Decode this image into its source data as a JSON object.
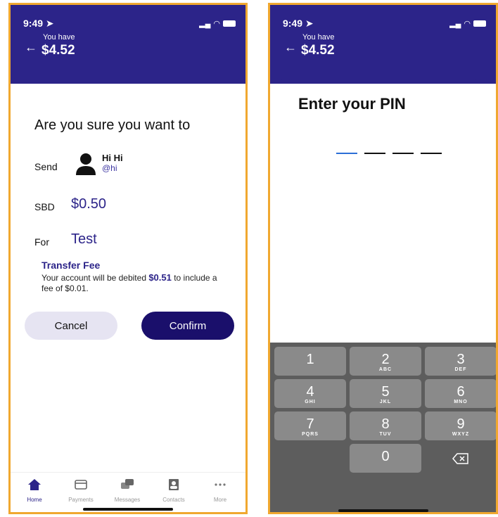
{
  "status": {
    "time": "9:49",
    "location_icon": "location-arrow-icon"
  },
  "left": {
    "header": {
      "you_have": "You have",
      "balance": "$4.52"
    },
    "title": "Are you sure you want to",
    "send_label": "Send",
    "recipient": {
      "name": "Hi Hi",
      "handle": "@hi"
    },
    "currency_label": "SBD",
    "amount": "$0.50",
    "for_label": "For",
    "memo": "Test",
    "fee": {
      "title": "Transfer Fee",
      "text_before": "Your account will be debited ",
      "debit_amount": "$0.51",
      "text_after": " to include a fee of $0.01."
    },
    "buttons": {
      "cancel": "Cancel",
      "confirm": "Confirm"
    },
    "tabs": [
      {
        "label": "Home",
        "icon": "home-icon"
      },
      {
        "label": "Payments",
        "icon": "card-icon"
      },
      {
        "label": "Messages",
        "icon": "messages-icon"
      },
      {
        "label": "Contacts",
        "icon": "contacts-icon"
      },
      {
        "label": "More",
        "icon": "more-icon"
      }
    ]
  },
  "right": {
    "header": {
      "you_have": "You have",
      "balance": "$4.52"
    },
    "title": "Enter your PIN",
    "keys": [
      {
        "num": "1",
        "letters": ""
      },
      {
        "num": "2",
        "letters": "ABC"
      },
      {
        "num": "3",
        "letters": "DEF"
      },
      {
        "num": "4",
        "letters": "GHI"
      },
      {
        "num": "5",
        "letters": "JKL"
      },
      {
        "num": "6",
        "letters": "MNO"
      },
      {
        "num": "7",
        "letters": "PQRS"
      },
      {
        "num": "8",
        "letters": "TUV"
      },
      {
        "num": "9",
        "letters": "WXYZ"
      },
      {
        "num": "0",
        "letters": ""
      }
    ],
    "delete_icon": "backspace-icon"
  },
  "colors": {
    "header": "#2c2489",
    "accent": "#1a0f6b",
    "frame": "#f0a830"
  }
}
